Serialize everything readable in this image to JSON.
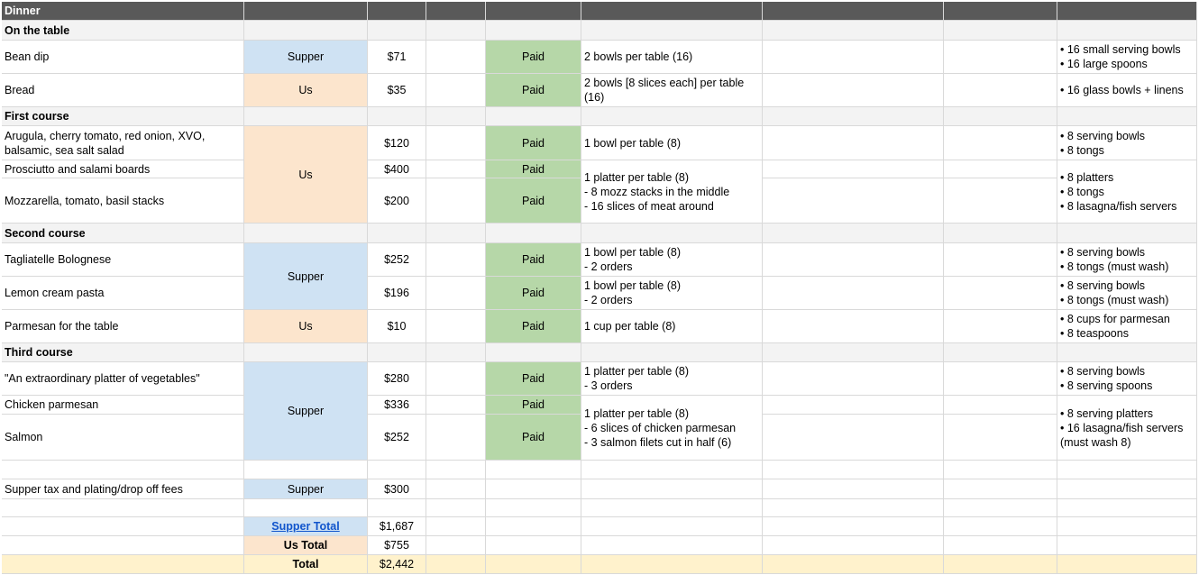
{
  "header": {
    "title": "Dinner"
  },
  "sections": {
    "on_table": "On the table",
    "first": "First course",
    "second": "Second course",
    "third": "Third course"
  },
  "items": {
    "bean_dip": {
      "name": "Bean dip",
      "vendor": "Supper",
      "price": "$71",
      "status": "Paid",
      "portion": "2 bowls per table (16)",
      "supplies": "• 16 small serving bowls\n• 16 large spoons"
    },
    "bread": {
      "name": "Bread",
      "vendor": "Us",
      "price": "$35",
      "status": "Paid",
      "portion": "2 bowls [8 slices each] per table\n(16)",
      "supplies": "• 16 glass bowls + linens"
    },
    "arugula": {
      "name": "Arugula, cherry tomato, red onion, XVO,\nbalsamic, sea salt salad",
      "price": "$120",
      "status": "Paid",
      "portion": "1 bowl per table (8)",
      "supplies": "• 8 serving bowls\n• 8 tongs"
    },
    "prosciutto": {
      "name": "Prosciutto and salami boards",
      "price": "$400",
      "status": "Paid"
    },
    "mozzarella": {
      "name": "Mozzarella, tomato, basil stacks",
      "price": "$200",
      "status": "Paid"
    },
    "first_vendor": "Us",
    "boards_portion": "1 platter per table (8)\n - 8 mozz stacks in the middle\n - 16 slices of meat around",
    "boards_supplies": "• 8 platters\n• 8 tongs\n• 8 lasagna/fish servers",
    "tagliatelle": {
      "name": "Tagliatelle Bolognese",
      "price": "$252",
      "status": "Paid",
      "portion": "1 bowl per table (8)\n - 2 orders",
      "supplies": "• 8 serving bowls\n• 8 tongs (must wash)"
    },
    "lemon": {
      "name": "Lemon cream pasta",
      "price": "$196",
      "status": "Paid",
      "portion": "1 bowl per table (8)\n - 2 orders",
      "supplies": "• 8 serving bowls\n• 8 tongs (must wash)"
    },
    "second_vendor": "Supper",
    "parmesan": {
      "name": "Parmesan for the table",
      "vendor": "Us",
      "price": "$10",
      "status": "Paid",
      "portion": "1 cup per table (8)",
      "supplies": "• 8 cups for parmesan\n• 8 teaspoons"
    },
    "platter_veg": {
      "name": "\"An extraordinary platter of vegetables\"",
      "price": "$280",
      "status": "Paid",
      "portion": "1 platter per table (8)\n - 3 orders",
      "supplies": "• 8 serving bowls\n• 8 serving spoons"
    },
    "chicken": {
      "name": "Chicken parmesan",
      "price": "$336",
      "status": "Paid"
    },
    "salmon": {
      "name": "Salmon",
      "price": "$252",
      "status": "Paid"
    },
    "third_vendor": "Supper",
    "third_portion": "1 platter per table (8)\n - 6 slices of chicken parmesan\n - 3 salmon filets cut in half (6)",
    "third_supplies": "• 8 serving platters\n• 16 lasagna/fish servers\n(must wash 8)",
    "fees": {
      "name": "Supper tax and plating/drop off fees",
      "vendor": "Supper",
      "price": "$300"
    }
  },
  "totals": {
    "supper_label": "Supper Total",
    "supper_value": "$1,687",
    "us_label": "Us Total",
    "us_value": "$755",
    "total_label": "Total",
    "total_value": "$2,442"
  },
  "colors": {
    "header": "#595959",
    "section": "#f3f3f3",
    "supper": "#cfe2f3",
    "us": "#fce5cd",
    "paid": "#b6d7a8",
    "total": "#fff2cc"
  }
}
